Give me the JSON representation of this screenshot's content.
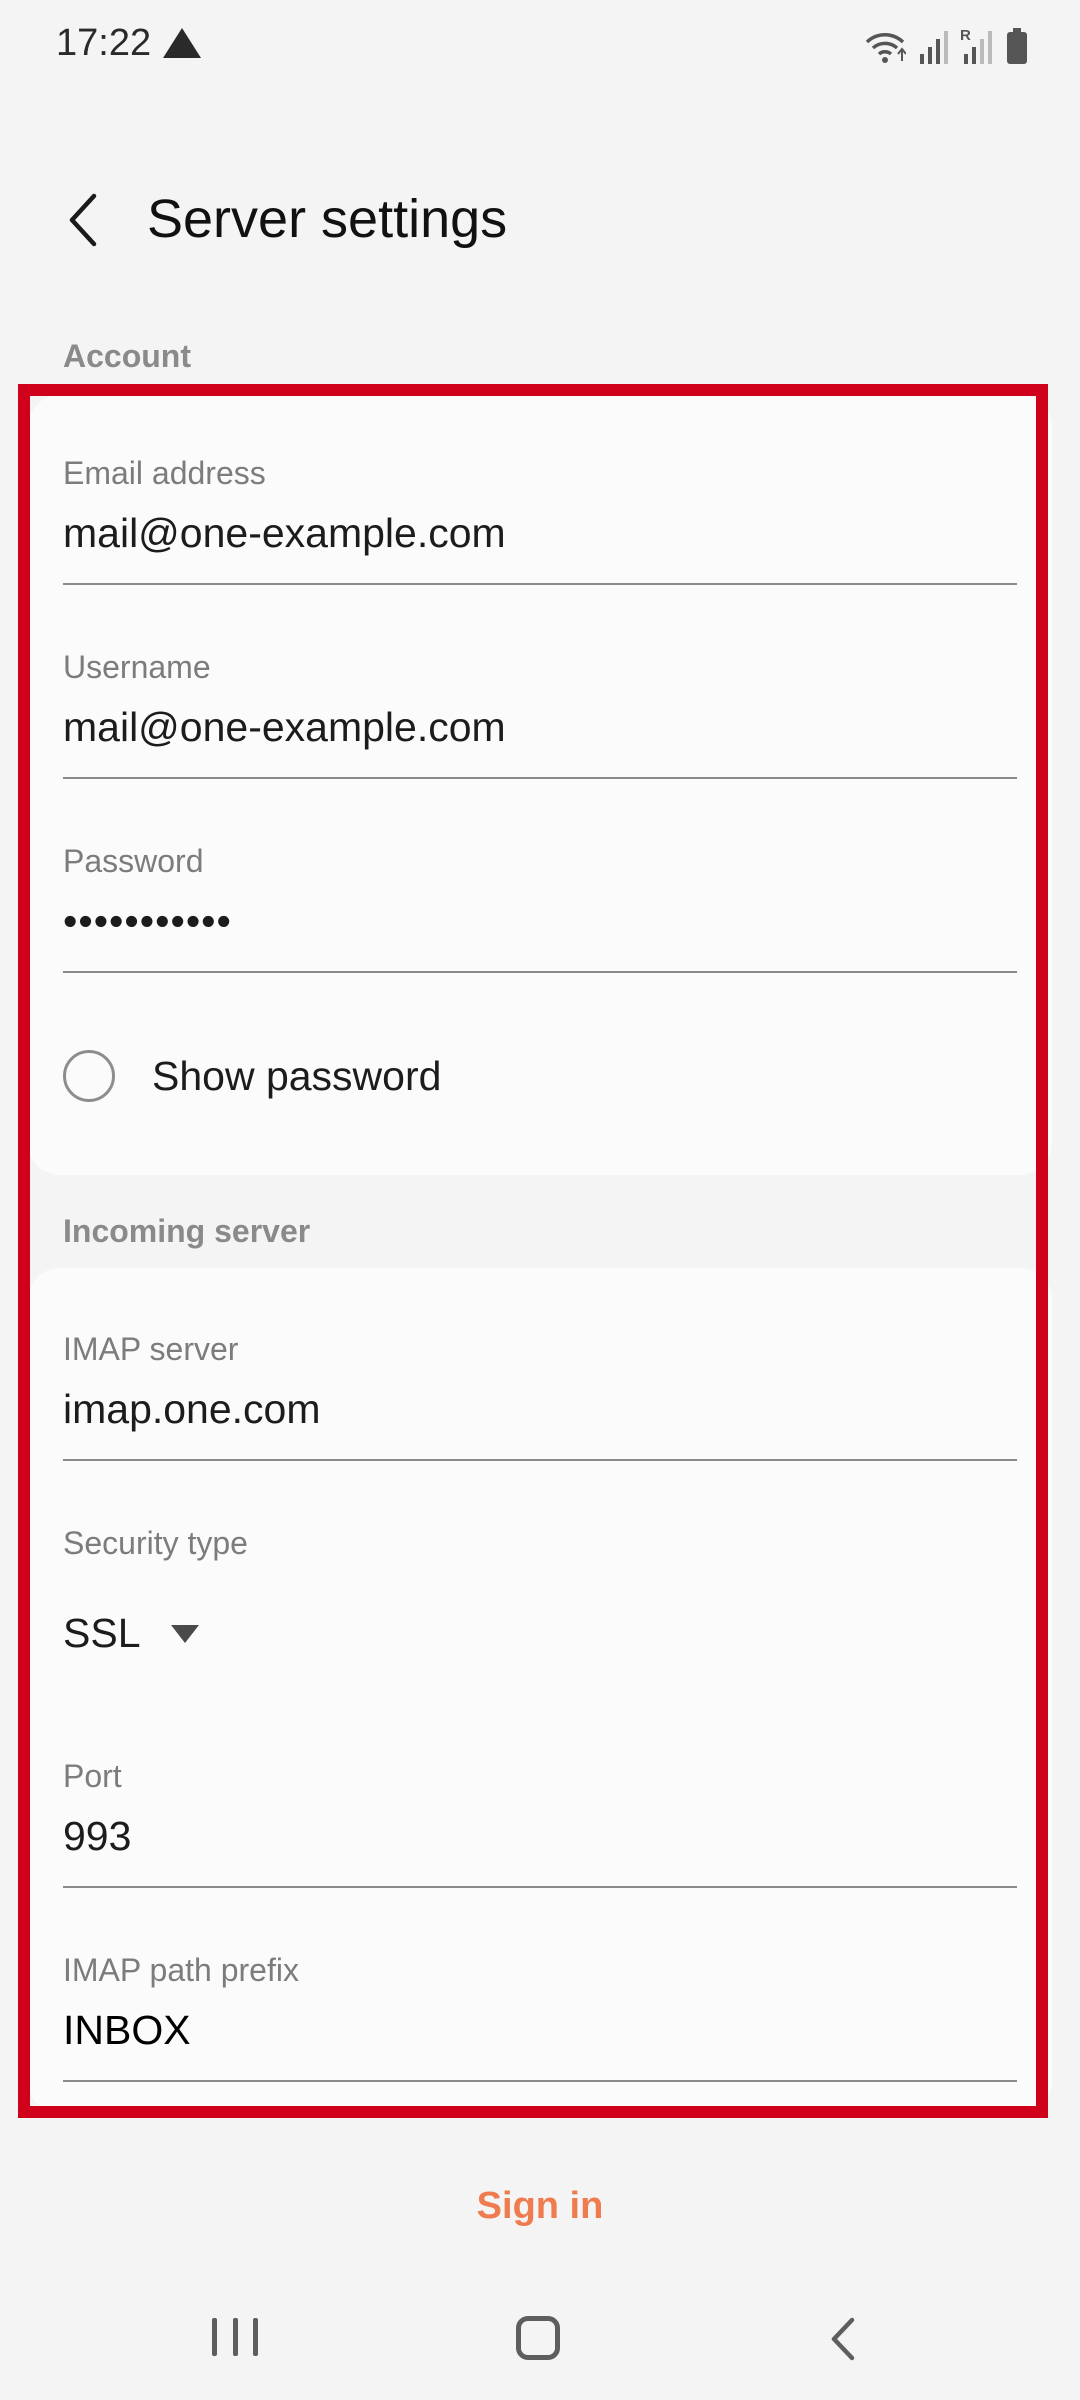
{
  "status_bar": {
    "time": "17:22",
    "icons": [
      "alert-icon",
      "wifi-icon",
      "signal-icon",
      "roaming-signal-icon",
      "battery-icon"
    ],
    "roaming_label": "R"
  },
  "header": {
    "title": "Server settings",
    "back_icon": "chevron-left-icon"
  },
  "account": {
    "section_label": "Account",
    "email_label": "Email address",
    "email_value": "mail@one-example.com",
    "username_label": "Username",
    "username_value": "mail@one-example.com",
    "password_label": "Password",
    "password_value": "•••••••••••",
    "show_password_label": "Show password",
    "show_password_checked": false
  },
  "incoming": {
    "section_label": "Incoming server",
    "imap_label": "IMAP server",
    "imap_value": "imap.one.com",
    "security_label": "Security type",
    "security_value": "SSL",
    "port_label": "Port",
    "port_value": "993",
    "prefix_label": "IMAP path prefix",
    "prefix_value": "INBOX"
  },
  "actions": {
    "sign_in_label": "Sign in"
  },
  "colors": {
    "highlight": "#d0021b",
    "accent": "#ef7c4e"
  },
  "nav_bar": {
    "icons": [
      "recents-icon",
      "home-icon",
      "back-icon"
    ]
  }
}
